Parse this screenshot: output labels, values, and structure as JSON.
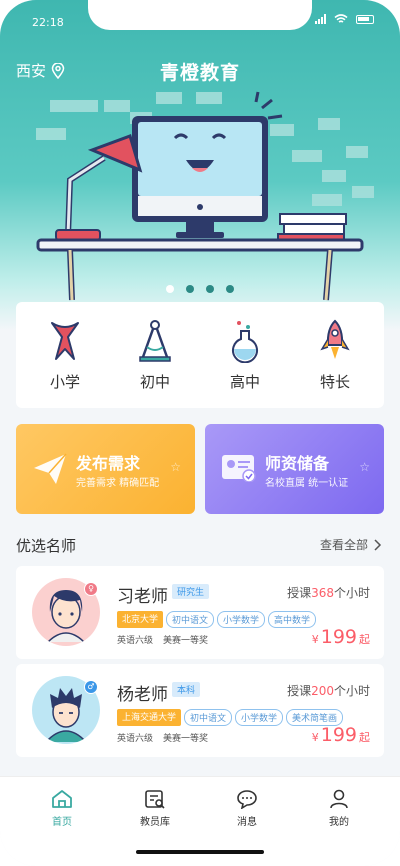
{
  "status": {
    "time": "22:18"
  },
  "header": {
    "city": "西安",
    "title": "青橙教育"
  },
  "carousel": {
    "count": 4,
    "active": 0
  },
  "categories": [
    {
      "label": "小学",
      "icon": "red-scarf-icon"
    },
    {
      "label": "初中",
      "icon": "compass-icon"
    },
    {
      "label": "高中",
      "icon": "flask-icon"
    },
    {
      "label": "特长",
      "icon": "rocket-icon"
    }
  ],
  "promos": [
    {
      "title": "发布需求",
      "subtitle": "完善需求  精确匹配",
      "icon": "paper-plane-icon",
      "color": "#fbb231"
    },
    {
      "title": "师资储备",
      "subtitle": "名校直属  统一认证",
      "icon": "id-card-icon",
      "color": "#7d69f0"
    }
  ],
  "section": {
    "title": "优选名师",
    "more": "查看全部"
  },
  "teachers": [
    {
      "name": "习老师",
      "degree": "研究生",
      "gender": "female",
      "hours_prefix": "授课",
      "hours": "368",
      "hours_suffix": "个小时",
      "school": "北京大学",
      "subjects": [
        "初中语文",
        "小学数学",
        "高中数学"
      ],
      "certs": [
        "英语六级",
        "美赛一等奖"
      ],
      "price_currency": "¥",
      "price": "199",
      "price_unit": "起"
    },
    {
      "name": "杨老师",
      "degree": "本科",
      "gender": "male",
      "hours_prefix": "授课",
      "hours": "200",
      "hours_suffix": "个小时",
      "school": "上海交通大学",
      "subjects": [
        "初中语文",
        "小学数学",
        "美术简笔画"
      ],
      "certs": [
        "英语六级",
        "美赛一等奖"
      ],
      "price_currency": "¥",
      "price": "199",
      "price_unit": "起"
    }
  ],
  "tabs": [
    {
      "label": "首页",
      "icon": "home-icon",
      "active": true
    },
    {
      "label": "教员库",
      "icon": "teacher-library-icon",
      "active": false
    },
    {
      "label": "消息",
      "icon": "message-icon",
      "active": false
    },
    {
      "label": "我的",
      "icon": "profile-icon",
      "active": false
    }
  ],
  "colors": {
    "primary": "#3aa9a1",
    "accent": "#fb5d68",
    "orange": "#fbb231",
    "purple": "#7d69f0"
  }
}
